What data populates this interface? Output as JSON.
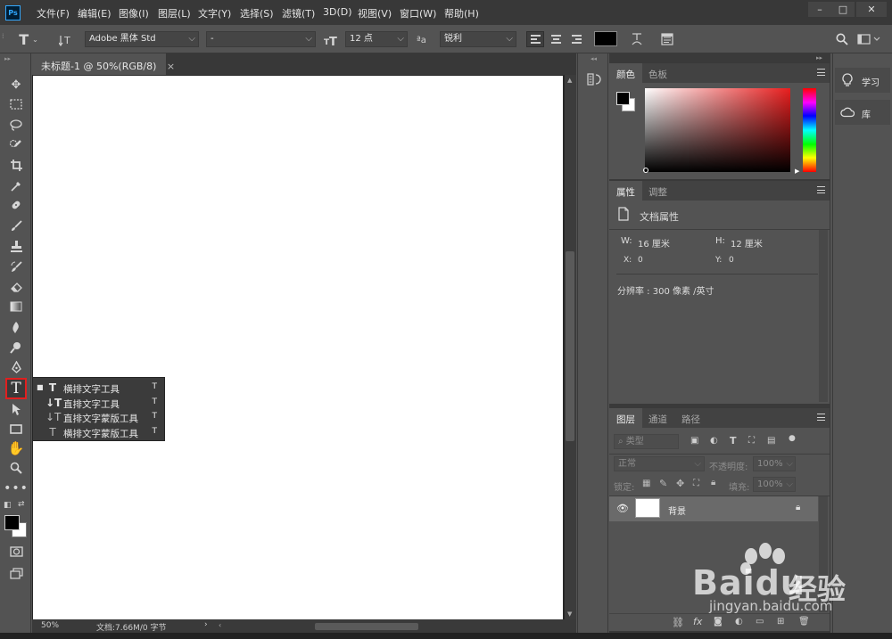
{
  "app": {
    "logo": "Ps"
  },
  "menus": [
    "文件(F)",
    "编辑(E)",
    "图像(I)",
    "图层(L)",
    "文字(Y)",
    "选择(S)",
    "滤镜(T)",
    "3D(D)",
    "视图(V)",
    "窗口(W)",
    "帮助(H)"
  ],
  "window_controls": {
    "minimize": "–",
    "maximize": "□",
    "close": "✕"
  },
  "options": {
    "tool_icon": "T",
    "font_family": "Adobe 黑体 Std",
    "font_style": "-",
    "font_size": "12 点",
    "aa_label": "ªa",
    "antialias": "锐利",
    "text_color": "#000000"
  },
  "document": {
    "tab_title": "未标题-1 @ 50%(RGB/8)",
    "tab_close": "×",
    "zoom": "50%",
    "doc_info": "文档:7.66M/0 字节",
    "arrow": "›"
  },
  "type_tool_flyout": [
    {
      "icon": "T",
      "label": "横排文字工具",
      "shortcut": "T",
      "active": true
    },
    {
      "icon": "↓T",
      "label": "直排文字工具",
      "shortcut": "T",
      "active": false
    },
    {
      "icon": "↓T",
      "label": "直排文字蒙版工具",
      "shortcut": "T",
      "active": false
    },
    {
      "icon": "T",
      "label": "横排文字蒙版工具",
      "shortcut": "T",
      "active": false
    }
  ],
  "panels": {
    "color": {
      "tabs": [
        "颜色",
        "色板"
      ],
      "foreground": "#000000",
      "background": "#ffffff"
    },
    "properties": {
      "tabs": [
        "属性",
        "调整"
      ],
      "title": "文档属性",
      "w_label": "W:",
      "w_value": "16 厘米",
      "h_label": "H:",
      "h_value": "12 厘米",
      "x_label": "X:",
      "x_value": "0",
      "y_label": "Y:",
      "y_value": "0",
      "resolution": "分辨率 : 300 像素 /英寸"
    },
    "layers": {
      "tabs": [
        "图层",
        "通道",
        "路径"
      ],
      "filter_kind": "类型",
      "blend_mode": "正常",
      "opacity_label": "不透明度:",
      "opacity_value": "100%",
      "lock_label": "锁定:",
      "fill_label": "填充:",
      "fill_value": "100%",
      "layer_name": "背景"
    }
  },
  "learn_panel": {
    "learn": "学习",
    "library": "库"
  },
  "watermark": {
    "brand": "Bai",
    "brand2": "du",
    "brand_cn": "经验",
    "url": "jingyan.baidu.com"
  }
}
